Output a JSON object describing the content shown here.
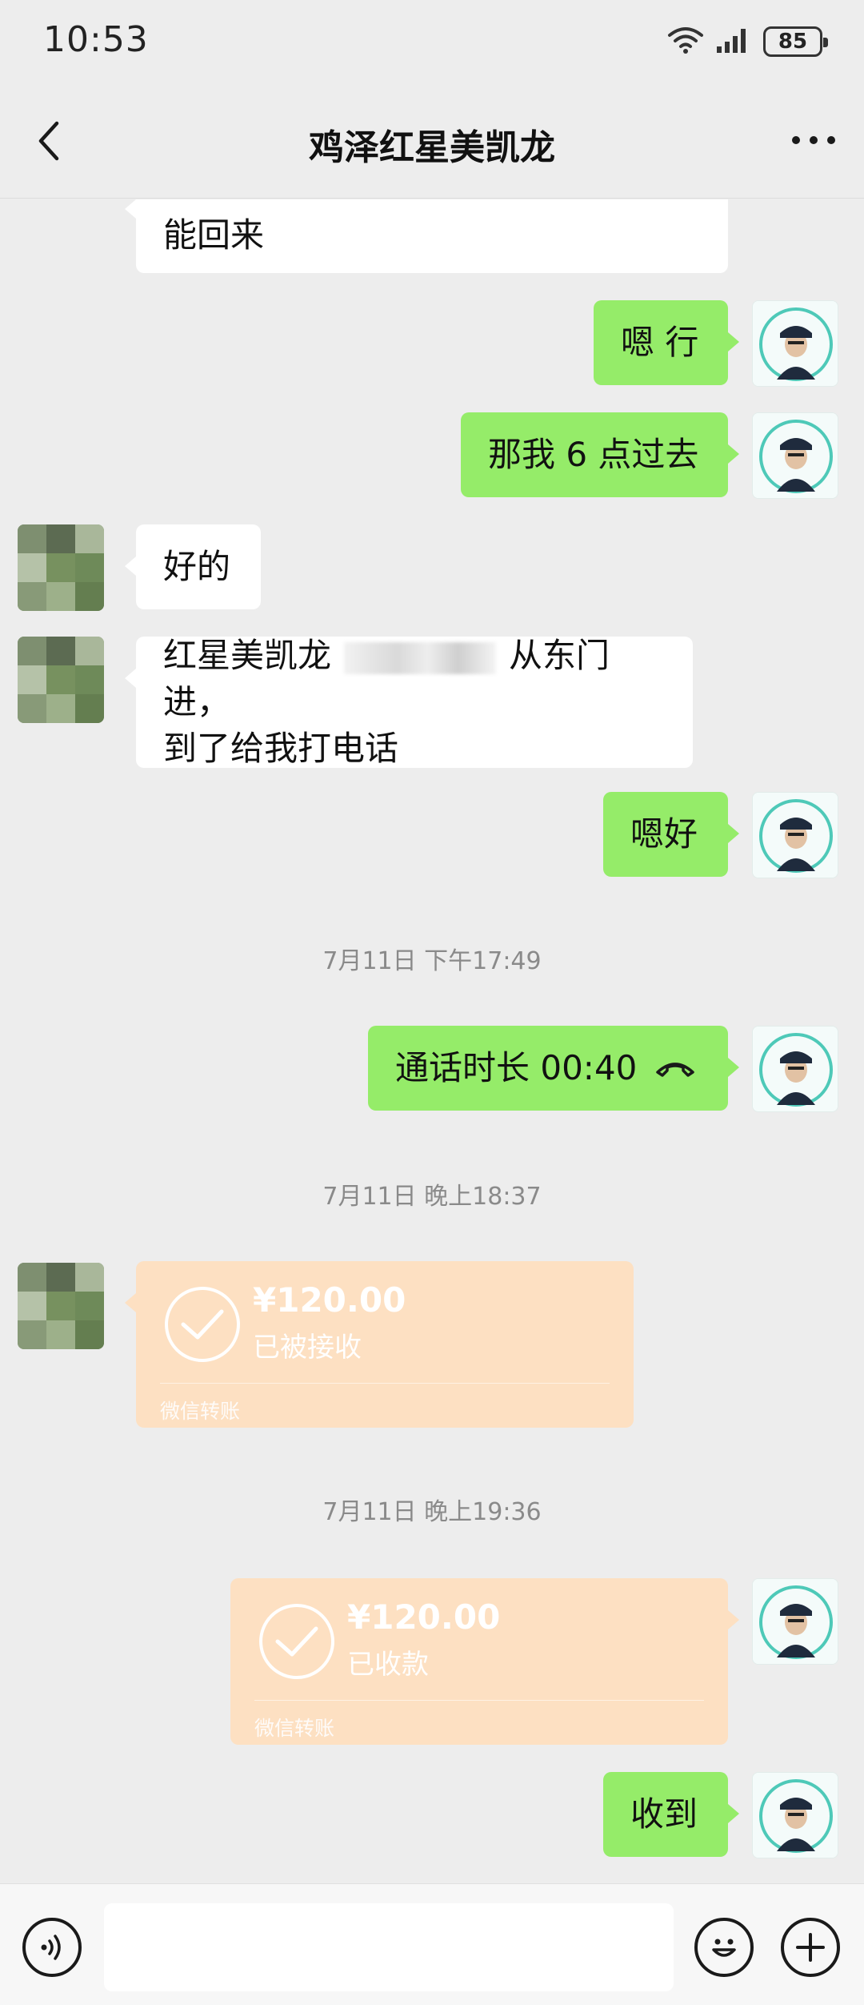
{
  "status_bar": {
    "time": "10:53",
    "battery": "85",
    "icons": [
      "wifi-icon",
      "signal-icon",
      "battery-icon"
    ]
  },
  "nav": {
    "title": "鸡泽红星美凯龙",
    "back_icon": "chevron-left-icon",
    "more_icon": "more-dots-icon"
  },
  "messages": [
    {
      "side": "in",
      "text_line1": "能回来"
    },
    {
      "side": "out",
      "text": "嗯 行"
    },
    {
      "side": "out",
      "text": "那我 6 点过去"
    },
    {
      "side": "in",
      "text": "好的"
    },
    {
      "side": "in",
      "text_part1": "红星美凯龙",
      "text_part2": "从东门进，",
      "text_line2": "到了给我打电话"
    },
    {
      "side": "out",
      "text": "嗯好"
    }
  ],
  "timestamps": [
    "7月11日 下午17:49",
    "7月11日 晚上18:37",
    "7月11日 晚上19:36"
  ],
  "call": {
    "label": "通话时长 00:40",
    "icon": "phone-hangup-icon"
  },
  "transfer_in": {
    "amount": "¥120.00",
    "status": "已被接收",
    "label": "微信转账"
  },
  "transfer_out": {
    "amount": "¥120.00",
    "status": "已收款",
    "label": "微信转账"
  },
  "last_message": {
    "side": "out",
    "text": "收到"
  },
  "colors": {
    "background": "#ededed",
    "outgoing_bubble": "#95ec69",
    "incoming_bubble": "#ffffff",
    "transfer": "#fde0c2"
  }
}
